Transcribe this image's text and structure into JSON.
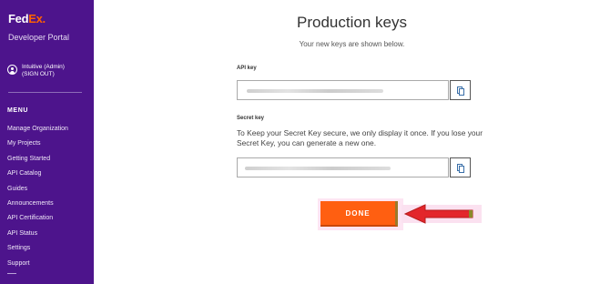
{
  "sidebar": {
    "logo_fed": "Fed",
    "logo_ex": "Ex",
    "logo_suffix": ".",
    "portal_name": "Developer Portal",
    "user_name": "Intuitive (Admin)",
    "sign_out": "(SIGN OUT)",
    "menu_title": "MENU",
    "menu_items": [
      {
        "label": "Manage Organization"
      },
      {
        "label": "My Projects"
      },
      {
        "label": "Getting Started"
      },
      {
        "label": "API Catalog"
      },
      {
        "label": "Guides"
      },
      {
        "label": "Announcements"
      },
      {
        "label": "API Certification"
      },
      {
        "label": "API Status"
      },
      {
        "label": "Settings"
      },
      {
        "label": "Support"
      }
    ]
  },
  "main": {
    "title": "Production keys",
    "subtitle": "Your new keys are shown below.",
    "api_key_label": "API key",
    "secret_key_label": "Secret key",
    "secret_key_description": "To Keep your Secret Key secure, we only display it once. If you lose your Secret Key, you can generate a new one.",
    "done_label": "DONE"
  },
  "colors": {
    "sidebar_bg": "#4d148c",
    "brand_orange": "#ff6200",
    "done_button": "#ff5f11",
    "arrow": "#e3262b"
  },
  "icons": {
    "user": "user-circle-icon",
    "copy": "copy-icon",
    "annotation_arrow": "arrow-left-icon"
  }
}
